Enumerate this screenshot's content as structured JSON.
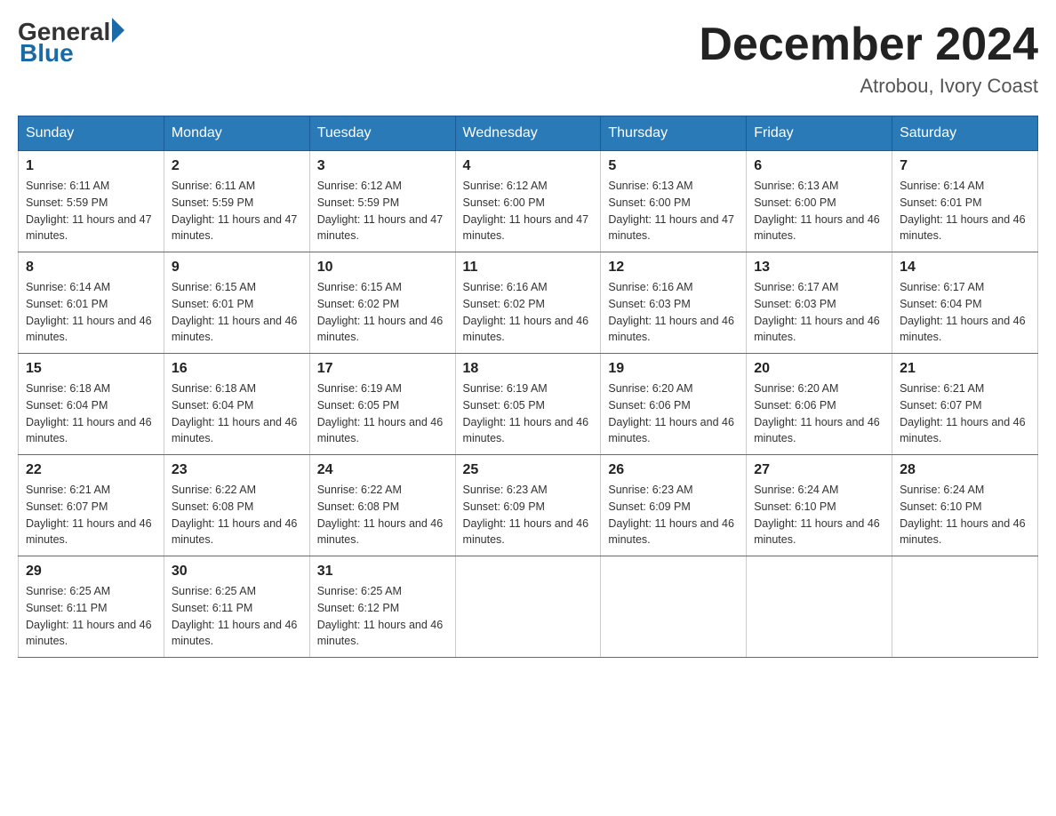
{
  "header": {
    "logo_general": "General",
    "logo_blue": "Blue",
    "month_title": "December 2024",
    "location": "Atrobou, Ivory Coast"
  },
  "days_of_week": [
    "Sunday",
    "Monday",
    "Tuesday",
    "Wednesday",
    "Thursday",
    "Friday",
    "Saturday"
  ],
  "weeks": [
    [
      {
        "day": "1",
        "sunrise": "6:11 AM",
        "sunset": "5:59 PM",
        "daylight": "11 hours and 47 minutes."
      },
      {
        "day": "2",
        "sunrise": "6:11 AM",
        "sunset": "5:59 PM",
        "daylight": "11 hours and 47 minutes."
      },
      {
        "day": "3",
        "sunrise": "6:12 AM",
        "sunset": "5:59 PM",
        "daylight": "11 hours and 47 minutes."
      },
      {
        "day": "4",
        "sunrise": "6:12 AM",
        "sunset": "6:00 PM",
        "daylight": "11 hours and 47 minutes."
      },
      {
        "day": "5",
        "sunrise": "6:13 AM",
        "sunset": "6:00 PM",
        "daylight": "11 hours and 47 minutes."
      },
      {
        "day": "6",
        "sunrise": "6:13 AM",
        "sunset": "6:00 PM",
        "daylight": "11 hours and 46 minutes."
      },
      {
        "day": "7",
        "sunrise": "6:14 AM",
        "sunset": "6:01 PM",
        "daylight": "11 hours and 46 minutes."
      }
    ],
    [
      {
        "day": "8",
        "sunrise": "6:14 AM",
        "sunset": "6:01 PM",
        "daylight": "11 hours and 46 minutes."
      },
      {
        "day": "9",
        "sunrise": "6:15 AM",
        "sunset": "6:01 PM",
        "daylight": "11 hours and 46 minutes."
      },
      {
        "day": "10",
        "sunrise": "6:15 AM",
        "sunset": "6:02 PM",
        "daylight": "11 hours and 46 minutes."
      },
      {
        "day": "11",
        "sunrise": "6:16 AM",
        "sunset": "6:02 PM",
        "daylight": "11 hours and 46 minutes."
      },
      {
        "day": "12",
        "sunrise": "6:16 AM",
        "sunset": "6:03 PM",
        "daylight": "11 hours and 46 minutes."
      },
      {
        "day": "13",
        "sunrise": "6:17 AM",
        "sunset": "6:03 PM",
        "daylight": "11 hours and 46 minutes."
      },
      {
        "day": "14",
        "sunrise": "6:17 AM",
        "sunset": "6:04 PM",
        "daylight": "11 hours and 46 minutes."
      }
    ],
    [
      {
        "day": "15",
        "sunrise": "6:18 AM",
        "sunset": "6:04 PM",
        "daylight": "11 hours and 46 minutes."
      },
      {
        "day": "16",
        "sunrise": "6:18 AM",
        "sunset": "6:04 PM",
        "daylight": "11 hours and 46 minutes."
      },
      {
        "day": "17",
        "sunrise": "6:19 AM",
        "sunset": "6:05 PM",
        "daylight": "11 hours and 46 minutes."
      },
      {
        "day": "18",
        "sunrise": "6:19 AM",
        "sunset": "6:05 PM",
        "daylight": "11 hours and 46 minutes."
      },
      {
        "day": "19",
        "sunrise": "6:20 AM",
        "sunset": "6:06 PM",
        "daylight": "11 hours and 46 minutes."
      },
      {
        "day": "20",
        "sunrise": "6:20 AM",
        "sunset": "6:06 PM",
        "daylight": "11 hours and 46 minutes."
      },
      {
        "day": "21",
        "sunrise": "6:21 AM",
        "sunset": "6:07 PM",
        "daylight": "11 hours and 46 minutes."
      }
    ],
    [
      {
        "day": "22",
        "sunrise": "6:21 AM",
        "sunset": "6:07 PM",
        "daylight": "11 hours and 46 minutes."
      },
      {
        "day": "23",
        "sunrise": "6:22 AM",
        "sunset": "6:08 PM",
        "daylight": "11 hours and 46 minutes."
      },
      {
        "day": "24",
        "sunrise": "6:22 AM",
        "sunset": "6:08 PM",
        "daylight": "11 hours and 46 minutes."
      },
      {
        "day": "25",
        "sunrise": "6:23 AM",
        "sunset": "6:09 PM",
        "daylight": "11 hours and 46 minutes."
      },
      {
        "day": "26",
        "sunrise": "6:23 AM",
        "sunset": "6:09 PM",
        "daylight": "11 hours and 46 minutes."
      },
      {
        "day": "27",
        "sunrise": "6:24 AM",
        "sunset": "6:10 PM",
        "daylight": "11 hours and 46 minutes."
      },
      {
        "day": "28",
        "sunrise": "6:24 AM",
        "sunset": "6:10 PM",
        "daylight": "11 hours and 46 minutes."
      }
    ],
    [
      {
        "day": "29",
        "sunrise": "6:25 AM",
        "sunset": "6:11 PM",
        "daylight": "11 hours and 46 minutes."
      },
      {
        "day": "30",
        "sunrise": "6:25 AM",
        "sunset": "6:11 PM",
        "daylight": "11 hours and 46 minutes."
      },
      {
        "day": "31",
        "sunrise": "6:25 AM",
        "sunset": "6:12 PM",
        "daylight": "11 hours and 46 minutes."
      },
      null,
      null,
      null,
      null
    ]
  ]
}
